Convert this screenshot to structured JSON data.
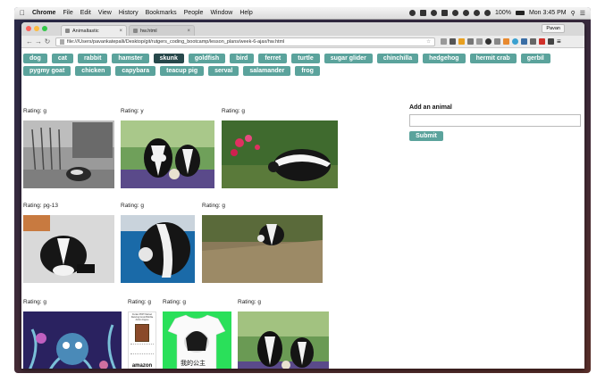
{
  "menubar": {
    "app_name": "Chrome",
    "items": [
      "File",
      "Edit",
      "View",
      "History",
      "Bookmarks",
      "People",
      "Window",
      "Help"
    ],
    "battery": "100%",
    "clock": "Mon 3:45 PM"
  },
  "browser": {
    "tabs": [
      {
        "title": "Animaltastic"
      },
      {
        "title": "hw.html"
      }
    ],
    "profile_name": "Pavan",
    "url": "file:///Users/pavankatepalli/Desktop/git/rutgers_coding_bootcamp/lesson_plans/week-6-ajax/hw.html"
  },
  "animals": [
    "dog",
    "cat",
    "rabbit",
    "hamster",
    "skunk",
    "goldfish",
    "bird",
    "ferret",
    "turtle",
    "sugar glider",
    "chinchilla",
    "hedgehog",
    "hermit crab",
    "gerbil",
    "pygmy goat",
    "chicken",
    "capybara",
    "teacup pig",
    "serval",
    "salamander",
    "frog"
  ],
  "active_animal": "skunk",
  "rating_prefix": "Rating: ",
  "gifs": [
    {
      "rating": "g"
    },
    {
      "rating": "y"
    },
    {
      "rating": "g"
    },
    {
      "rating": "pg-13"
    },
    {
      "rating": "g"
    },
    {
      "rating": "g"
    },
    {
      "rating": "g"
    },
    {
      "rating": "g"
    },
    {
      "rating": "g"
    },
    {
      "rating": "g"
    }
  ],
  "form": {
    "label": "Add an animal",
    "input_value": "",
    "submit_label": "Submit"
  },
  "product_card": {
    "title": "Funko POP! Marvel Dancing Groot Bobble Action Figure",
    "brand": "amazon"
  },
  "tshirt_text": "我的公主"
}
